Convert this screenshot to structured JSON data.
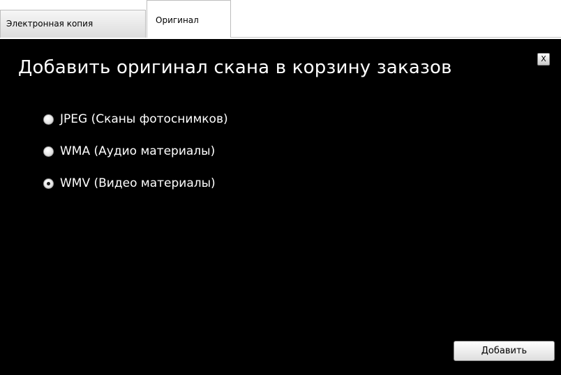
{
  "tabs": [
    {
      "label": "Электронная копия",
      "active": false
    },
    {
      "label": "Оригинал",
      "active": true
    }
  ],
  "dialog": {
    "title": "Добавить оригинал скана в корзину заказов",
    "close_label": "X",
    "options": [
      {
        "label": "JPEG (Сканы фотоснимков)",
        "checked": false
      },
      {
        "label": "WMA (Аудио материалы)",
        "checked": false
      },
      {
        "label": "WMV (Видео материалы)",
        "checked": true
      }
    ],
    "add_button_label": "Добавить"
  },
  "colors": {
    "dialog_background": "#000000",
    "dialog_text": "#ffffff",
    "page_background": "#ffffff"
  }
}
